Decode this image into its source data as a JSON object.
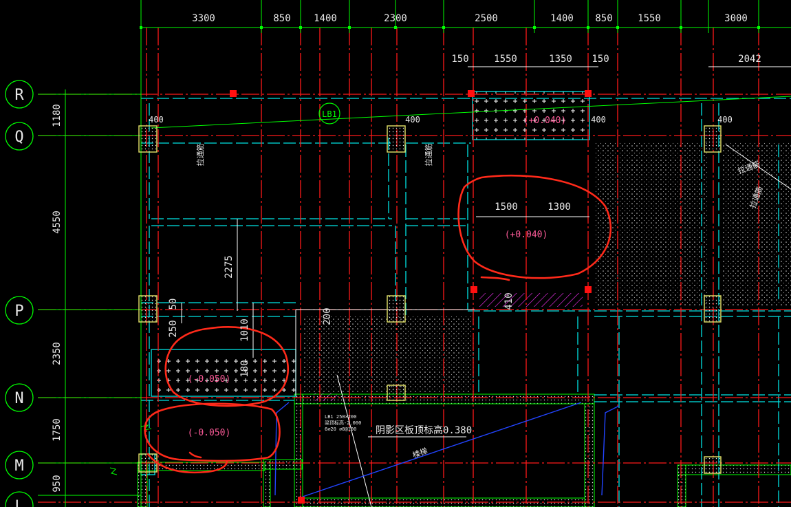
{
  "colors": {
    "background": "#000000",
    "grid_axis": "#ff0000",
    "dimension": "#00ff00",
    "beam": "#00ffff",
    "slab_text": "#ff5c9a",
    "markup": "#ff2a1a",
    "column": "#ffff66",
    "stair_line": "#2244ff",
    "hatch": "#ffffff"
  },
  "top_dimensions": [
    "3300",
    "850",
    "1400",
    "2300",
    "2500",
    "1400",
    "850",
    "1550",
    "3000"
  ],
  "second_dimensions": [
    "150",
    "1550",
    "1350",
    "150",
    "2042"
  ],
  "left_dimensions": [
    "1180",
    "4550",
    "2350",
    "1750",
    "950"
  ],
  "grid_labels": [
    "R",
    "Q",
    "P",
    "N",
    "M",
    "L"
  ],
  "column_size_labels": [
    "400",
    "400",
    "400",
    "400"
  ],
  "beam_label": "LB1",
  "slab_elevations": {
    "top_hatched": "(+0.040)",
    "right_center": "(+0.040)",
    "left_hatched": "(-0.050)",
    "left_lower": "(-0.050)"
  },
  "inner_dimensions": {
    "upper_center_a": "1500",
    "upper_center_b": "1300",
    "vertical_2275": "2275",
    "vertical_1010": "1010",
    "vertical_250": "250",
    "vertical_50": "50",
    "vertical_200": "200",
    "vertical_180": "180",
    "vertical_410": "410"
  },
  "annotations": {
    "stair_top_elev": "阴影区板顶标高0.380",
    "stair_label": "楼梯",
    "rebar_label": "拉通筋",
    "beam_spec_1": "LB1 250×200",
    "beam_spec_2": "梁顶标高-2.000",
    "beam_spec_3": "6⌀20 ⌀8@100"
  }
}
